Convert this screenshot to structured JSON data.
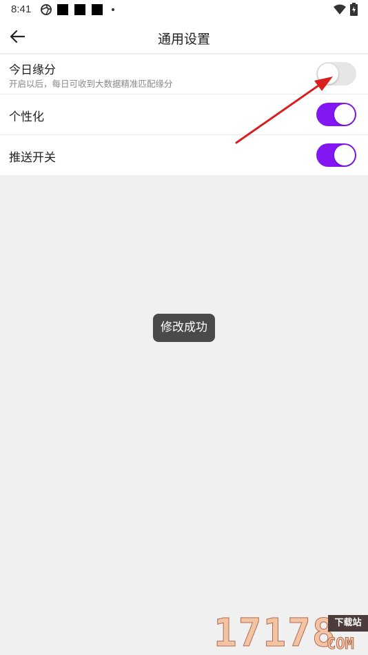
{
  "status_bar": {
    "time": "8:41",
    "icons": [
      "aperture-icon",
      "notification-block-icon",
      "notification-block-icon",
      "notification-block-icon",
      "dot-icon",
      "wifi-icon",
      "battery-charging-icon"
    ]
  },
  "header": {
    "title": "通用设置",
    "back_icon": "arrow-left-icon"
  },
  "settings": [
    {
      "title": "今日缘分",
      "subtitle": "开启以后，每日可收到大数据精准匹配缘分",
      "enabled": false
    },
    {
      "title": "个性化",
      "enabled": true
    },
    {
      "title": "推送开关",
      "enabled": true
    }
  ],
  "toast": {
    "message": "修改成功"
  },
  "watermark": {
    "digits": "17178",
    "badge": "下载站",
    "suffix": "COM"
  },
  "colors": {
    "switch_on": "#8217f3",
    "switch_off": "#e6e6e6",
    "background": "#f0f0f0",
    "toast_bg": "#4a4a4a",
    "annotation_arrow": "#d81e1e"
  }
}
